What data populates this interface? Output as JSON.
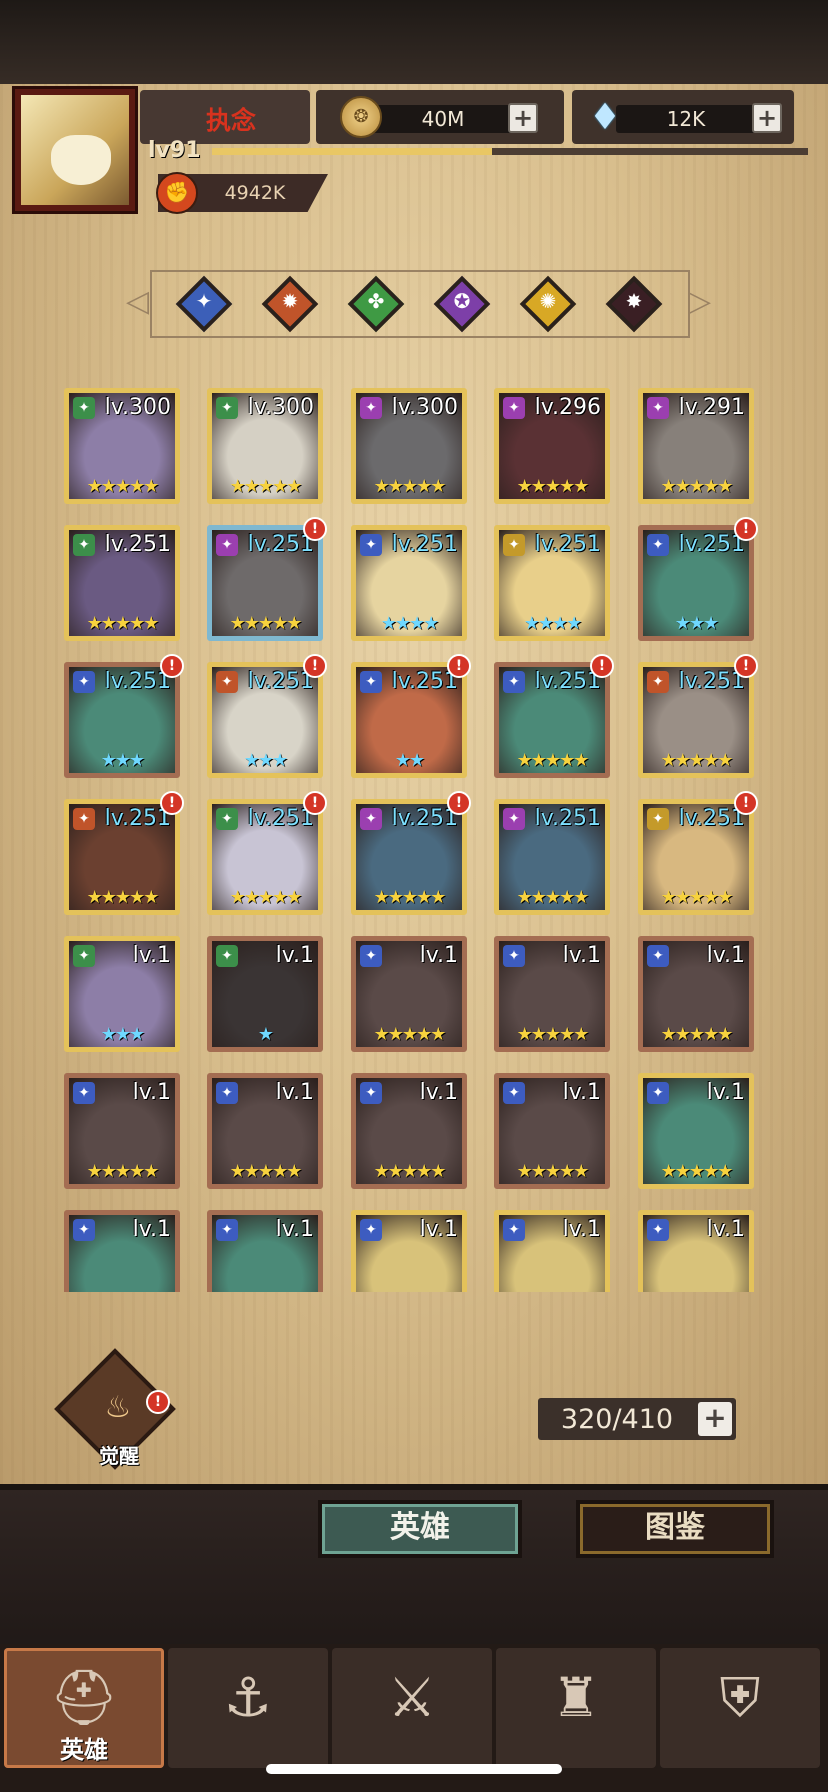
{
  "player": {
    "name": "执念",
    "level": "lv91",
    "xp_fraction": 0.47,
    "power": "4942K"
  },
  "resources": {
    "gold": "40M",
    "gems": "12K"
  },
  "filters": [
    {
      "name": "filter-blue",
      "color": "#3c5fb8",
      "sym": "✦"
    },
    {
      "name": "filter-orange",
      "color": "#c0542a",
      "sym": "✹"
    },
    {
      "name": "filter-green",
      "color": "#3f9a44",
      "sym": "✤"
    },
    {
      "name": "filter-purple",
      "color": "#7d3fa8",
      "sym": "✪"
    },
    {
      "name": "filter-yellow",
      "color": "#d8a825",
      "sym": "✺"
    },
    {
      "name": "filter-dark",
      "color": "#3a1f24",
      "sym": "✸"
    }
  ],
  "heroes": [
    {
      "lv": "lv.300",
      "stars": "★★★★★",
      "frame": "gold",
      "cls": "#3c8f4a",
      "face": "#8d7ea7",
      "cyan": false,
      "alert": false
    },
    {
      "lv": "lv.300",
      "stars": "★★★★★",
      "frame": "gold",
      "cls": "#3c8f4a",
      "face": "#d5d0c4",
      "cyan": false,
      "alert": false
    },
    {
      "lv": "lv.300",
      "stars": "★★★★★",
      "frame": "gold",
      "cls": "#9b3fb0",
      "face": "#6b6a6c",
      "cyan": false,
      "alert": false
    },
    {
      "lv": "lv.296",
      "stars": "★★★★★",
      "frame": "gold",
      "cls": "#9b3fb0",
      "face": "#5a3134",
      "cyan": false,
      "alert": false
    },
    {
      "lv": "lv.291",
      "stars": "★★★★★",
      "frame": "gold",
      "cls": "#9b3fb0",
      "face": "#87807a",
      "cyan": false,
      "alert": false
    },
    {
      "lv": "lv.251",
      "stars": "★★★★★",
      "frame": "gold",
      "cls": "#3c8f4a",
      "face": "#6a5a82",
      "cyan": false,
      "alert": false
    },
    {
      "lv": "lv.251",
      "stars": "★★★★★",
      "frame": "blue",
      "cls": "#9b3fb0",
      "face": "#6e6a6a",
      "cyan": true,
      "alert": true
    },
    {
      "lv": "lv.251",
      "stars": "★★★★",
      "frame": "gold",
      "cls": "#3d5cc0",
      "face": "#e6d4a0",
      "cyan": true,
      "alert": false
    },
    {
      "lv": "lv.251",
      "stars": "★★★★",
      "frame": "gold",
      "cls": "#c49a2a",
      "face": "#e8cf8a",
      "cyan": true,
      "alert": false
    },
    {
      "lv": "lv.251",
      "stars": "★★★",
      "frame": "purple",
      "cls": "#3d5cc0",
      "face": "#4b8a78",
      "cyan": true,
      "alert": true
    },
    {
      "lv": "lv.251",
      "stars": "★★★",
      "frame": "purple",
      "cls": "#3d5cc0",
      "face": "#4b8a78",
      "cyan": true,
      "alert": true
    },
    {
      "lv": "lv.251",
      "stars": "★★★",
      "frame": "gold",
      "cls": "#c0542a",
      "face": "#d8d4c8",
      "cyan": true,
      "alert": true
    },
    {
      "lv": "lv.251",
      "stars": "★★",
      "frame": "gold",
      "cls": "#3d5cc0",
      "face": "#c06a48",
      "cyan": true,
      "alert": true
    },
    {
      "lv": "lv.251",
      "stars": "★★★★★",
      "frame": "purple",
      "cls": "#3d5cc0",
      "face": "#4b8a78",
      "cyan": true,
      "alert": true
    },
    {
      "lv": "lv.251",
      "stars": "★★★★★",
      "frame": "gold",
      "cls": "#c0542a",
      "face": "#9a8f86",
      "cyan": true,
      "alert": true
    },
    {
      "lv": "lv.251",
      "stars": "★★★★★",
      "frame": "gold",
      "cls": "#c0542a",
      "face": "#6b4030",
      "cyan": true,
      "alert": true
    },
    {
      "lv": "lv.251",
      "stars": "★★★★★",
      "frame": "gold",
      "cls": "#3c8f4a",
      "face": "#c8c4d4",
      "cyan": true,
      "alert": true
    },
    {
      "lv": "lv.251",
      "stars": "★★★★★",
      "frame": "gold",
      "cls": "#9b3fb0",
      "face": "#4a6a80",
      "cyan": true,
      "alert": true
    },
    {
      "lv": "lv.251",
      "stars": "★★★★★",
      "frame": "gold",
      "cls": "#9b3fb0",
      "face": "#4a6a80",
      "cyan": true,
      "alert": false
    },
    {
      "lv": "lv.251",
      "stars": "★★★★★",
      "frame": "gold",
      "cls": "#c49a2a",
      "face": "#d8b880",
      "cyan": true,
      "alert": true
    },
    {
      "lv": "lv.1",
      "stars": "★★★",
      "frame": "gold",
      "cls": "#3c8f4a",
      "face": "#8d7ea7",
      "cyan": false,
      "alert": false
    },
    {
      "lv": "lv.1",
      "stars": "★",
      "frame": "purple",
      "cls": "#3c8f4a",
      "face": "#3a3434",
      "cyan": false,
      "alert": false
    },
    {
      "lv": "lv.1",
      "stars": "★★★★★",
      "frame": "purple",
      "cls": "#3d5cc0",
      "face": "#5a4a48",
      "cyan": false,
      "alert": false
    },
    {
      "lv": "lv.1",
      "stars": "★★★★★",
      "frame": "purple",
      "cls": "#3d5cc0",
      "face": "#5a4a48",
      "cyan": false,
      "alert": false
    },
    {
      "lv": "lv.1",
      "stars": "★★★★★",
      "frame": "purple",
      "cls": "#3d5cc0",
      "face": "#5a4a48",
      "cyan": false,
      "alert": false
    },
    {
      "lv": "lv.1",
      "stars": "★★★★★",
      "frame": "purple",
      "cls": "#3d5cc0",
      "face": "#5a4a48",
      "cyan": false,
      "alert": false
    },
    {
      "lv": "lv.1",
      "stars": "★★★★★",
      "frame": "purple",
      "cls": "#3d5cc0",
      "face": "#5a4a48",
      "cyan": false,
      "alert": false
    },
    {
      "lv": "lv.1",
      "stars": "★★★★★",
      "frame": "purple",
      "cls": "#3d5cc0",
      "face": "#5a4a48",
      "cyan": false,
      "alert": false
    },
    {
      "lv": "lv.1",
      "stars": "★★★★★",
      "frame": "purple",
      "cls": "#3d5cc0",
      "face": "#5a4a48",
      "cyan": false,
      "alert": false
    },
    {
      "lv": "lv.1",
      "stars": "★★★★★",
      "frame": "gold",
      "cls": "#3d5cc0",
      "face": "#4b8a78",
      "cyan": false,
      "alert": false
    },
    {
      "lv": "lv.1",
      "stars": "",
      "frame": "purple",
      "cls": "#3d5cc0",
      "face": "#4b8a78",
      "cyan": false,
      "alert": false
    },
    {
      "lv": "lv.1",
      "stars": "",
      "frame": "purple",
      "cls": "#3d5cc0",
      "face": "#4b8a78",
      "cyan": false,
      "alert": false
    },
    {
      "lv": "lv.1",
      "stars": "",
      "frame": "gold",
      "cls": "#3d5cc0",
      "face": "#d8c27a",
      "cyan": false,
      "alert": false
    },
    {
      "lv": "lv.1",
      "stars": "",
      "frame": "gold",
      "cls": "#3d5cc0",
      "face": "#d8c27a",
      "cyan": false,
      "alert": false
    },
    {
      "lv": "lv.1",
      "stars": "",
      "frame": "gold",
      "cls": "#3d5cc0",
      "face": "#d8c27a",
      "cyan": false,
      "alert": false
    }
  ],
  "awaken": {
    "label": "觉醒"
  },
  "capacity": {
    "text": "320/410"
  },
  "tabs": {
    "hero": "英雄",
    "atlas": "图鉴"
  },
  "nav": [
    {
      "name": "nav-heroes",
      "label": "英雄",
      "active": true,
      "icon": "⛑"
    },
    {
      "name": "nav-expedition",
      "label": "",
      "active": false,
      "icon": "⚓"
    },
    {
      "name": "nav-battle",
      "label": "",
      "active": false,
      "icon": "⚔"
    },
    {
      "name": "nav-castle",
      "label": "",
      "active": false,
      "icon": "♜"
    },
    {
      "name": "nav-guild",
      "label": "",
      "active": false,
      "icon": "⛨"
    }
  ]
}
